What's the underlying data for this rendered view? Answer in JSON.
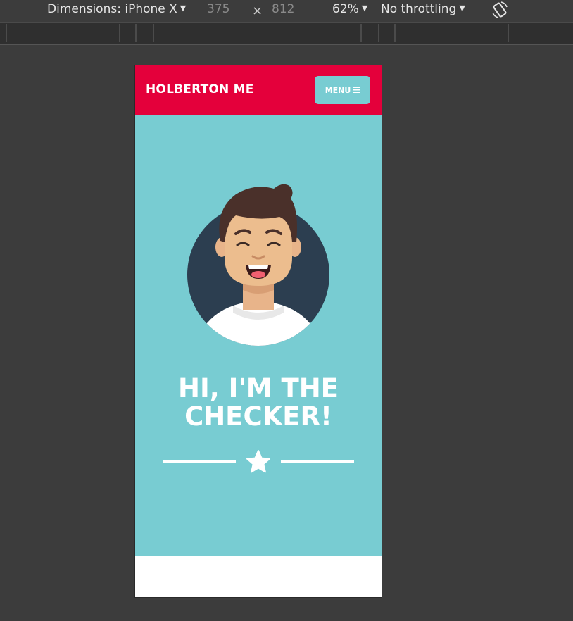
{
  "devtools": {
    "device_label": "Dimensions: iPhone X",
    "width": "375",
    "times": "×",
    "height": "812",
    "zoom": "62%",
    "throttle": "No throttling"
  },
  "page": {
    "brand": "HOLBERTON ME",
    "menu_label": "MENU",
    "hero_line1": "HI, I'M THE",
    "hero_line2": "CHECKER!"
  },
  "colors": {
    "header": "#e4003b",
    "hero": "#78ccd2",
    "avatar_bg": "#2c3e50"
  }
}
